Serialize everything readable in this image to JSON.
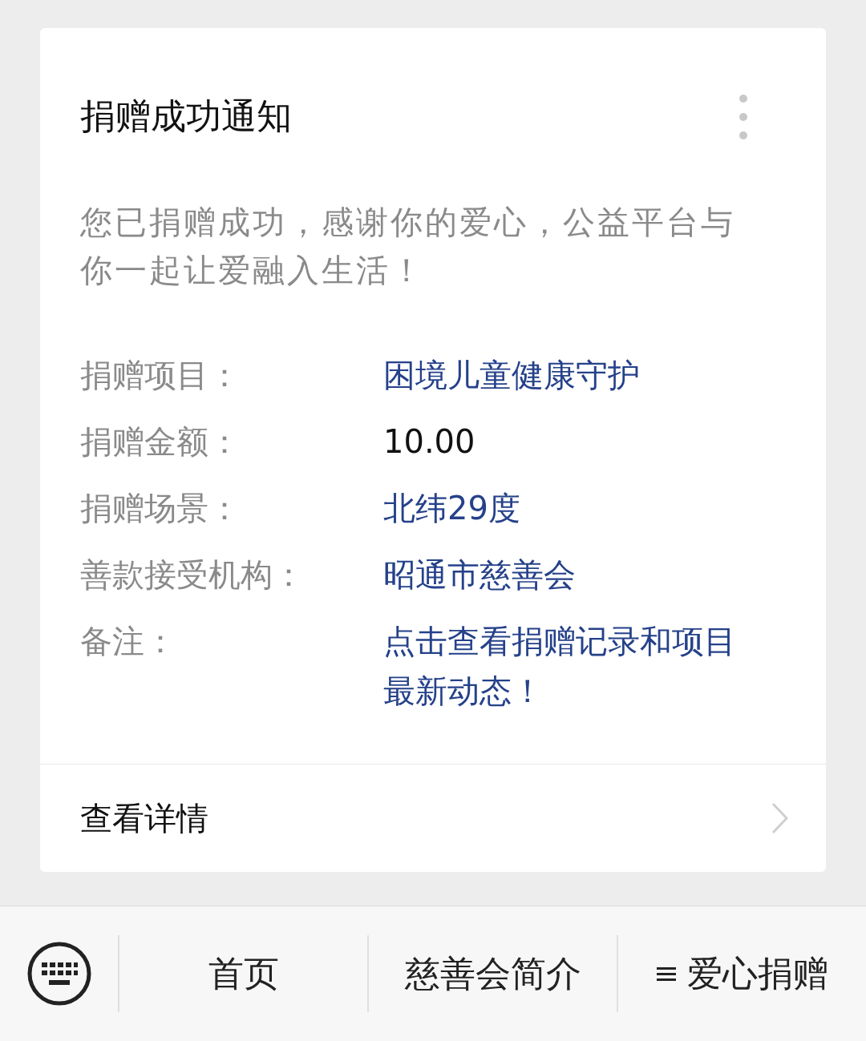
{
  "card": {
    "title": "捐赠成功通知",
    "message": "您已捐赠成功，感谢你的爱心，公益平台与你一起让爱融入生活！",
    "fields": [
      {
        "label": "捐赠项目：",
        "value": "困境儿童健康守护",
        "kind": "link"
      },
      {
        "label": "捐赠金额：",
        "value": "10.00",
        "kind": "plain"
      },
      {
        "label": "捐赠场景：",
        "value": "北纬29度",
        "kind": "link"
      },
      {
        "label": "善款接受机构：",
        "value": "昭通市慈善会",
        "kind": "link"
      },
      {
        "label": "备注：",
        "value": "点击查看捐赠记录和项目最新动态！",
        "kind": "link"
      }
    ],
    "details_link": "查看详情"
  },
  "bottom_menu": [
    {
      "label": "首页",
      "menu": false
    },
    {
      "label": "慈善会简介",
      "menu": false
    },
    {
      "label": "爱心捐赠",
      "menu": true
    }
  ]
}
